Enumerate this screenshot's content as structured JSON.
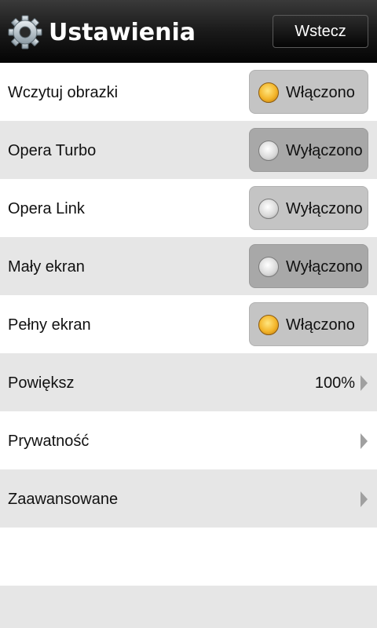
{
  "header": {
    "title": "Ustawienia",
    "back_label": "Wstecz"
  },
  "settings": [
    {
      "label": "Wczytuj obrazki",
      "state": "Włączono",
      "on": true
    },
    {
      "label": "Opera Turbo",
      "state": "Wyłączono",
      "on": false
    },
    {
      "label": "Opera Link",
      "state": "Wyłączono",
      "on": false
    },
    {
      "label": "Mały ekran",
      "state": "Wyłączono",
      "on": false
    },
    {
      "label": "Pełny ekran",
      "state": "Włączono",
      "on": true
    }
  ],
  "nav_items": [
    {
      "label": "Powiększ",
      "value": "100%"
    },
    {
      "label": "Prywatność",
      "value": ""
    },
    {
      "label": "Zaawansowane",
      "value": ""
    }
  ],
  "colors": {
    "header_bg": "#1a1a1a",
    "row_alt": "#e6e6e6",
    "toggle_on": "#f3b52a",
    "toggle_off": "#d8d8d8"
  },
  "icons": {
    "header": "gear-icon",
    "toggle_on": "status-on-dot-icon",
    "toggle_off": "status-off-dot-icon",
    "nav": "chevron-right-icon"
  }
}
